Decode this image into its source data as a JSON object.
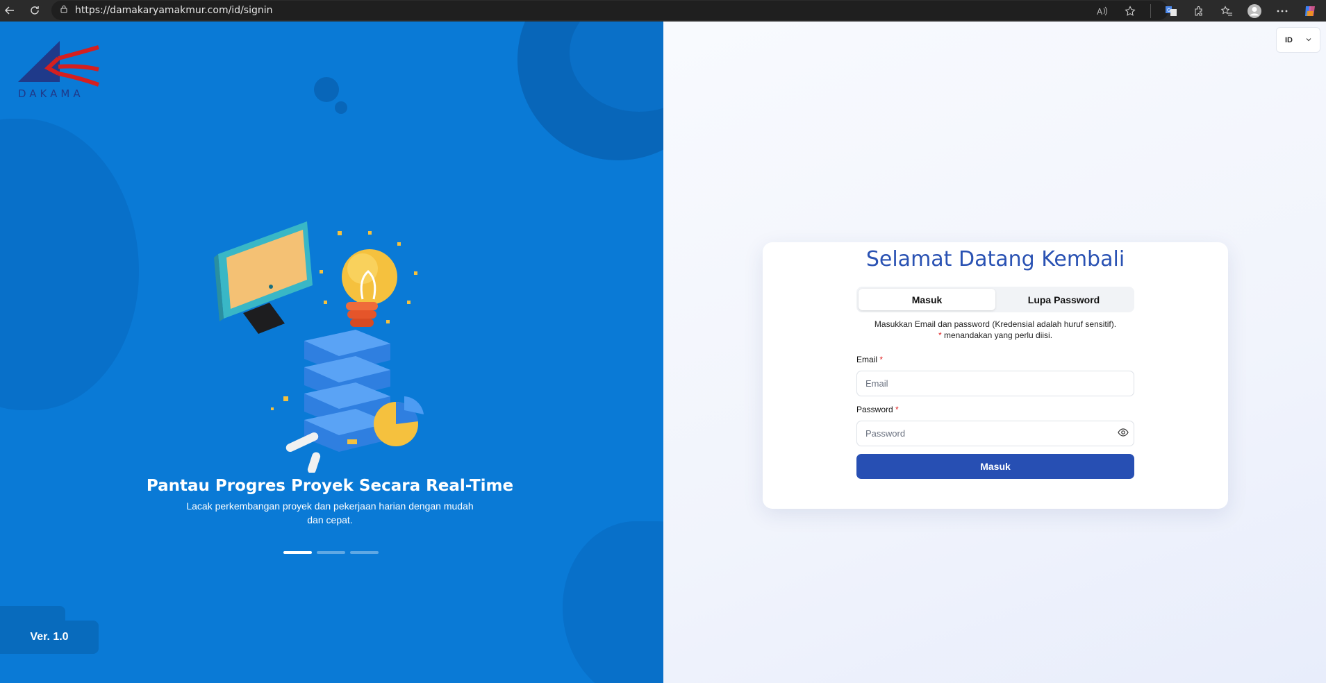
{
  "browser": {
    "url": "https://damakaryamakmur.com/id/signin",
    "icons": [
      "back-icon",
      "refresh-icon",
      "lock-icon",
      "read-aloud-icon",
      "favorite-icon",
      "translate-icon",
      "extensions-icon",
      "favorites-bar-icon",
      "profile-icon",
      "more-icon",
      "copilot-icon"
    ]
  },
  "left": {
    "logo_text": "DAKAMA",
    "slide_title": "Pantau Progres Proyek Secara Real-Time",
    "slide_desc": "Lacak perkembangan proyek dan pekerjaan harian dengan mudah dan cepat.",
    "slides_total": 3,
    "slide_active": 1,
    "version": "Ver. 1.0"
  },
  "right": {
    "language": "ID",
    "title": "Selamat Datang Kembali",
    "tabs": [
      {
        "label": "Masuk",
        "active": true
      },
      {
        "label": "Lupa Password",
        "active": false
      }
    ],
    "instruction_line1": "Masukkan Email dan password (Kredensial adalah huruf sensitif).",
    "instruction_req": "*",
    "instruction_line2": "menandakan yang perlu diisi.",
    "email": {
      "label": "Email",
      "placeholder": "Email",
      "value": ""
    },
    "password": {
      "label": "Password",
      "placeholder": "Password",
      "value": ""
    },
    "required_marker": "*",
    "submit_label": "Masuk"
  },
  "colors": {
    "left_bg": "#0a7ad6",
    "primary": "#274fb3",
    "title": "#2a52b3",
    "required": "#e02424"
  }
}
